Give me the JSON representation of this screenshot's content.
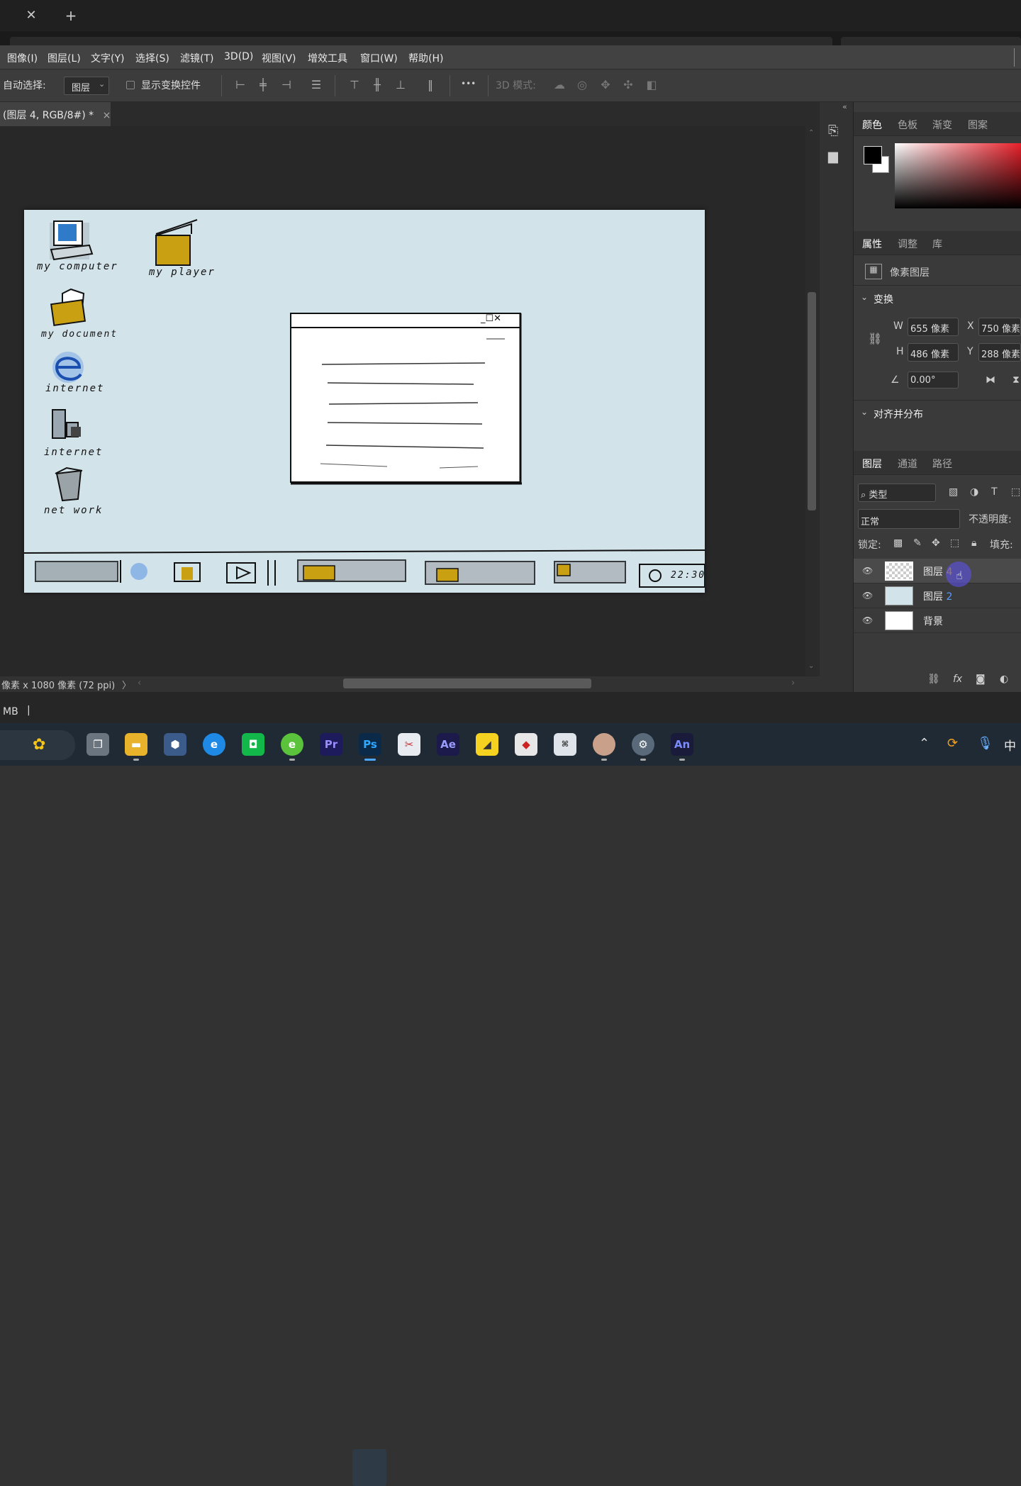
{
  "tabs": {
    "close_glyph": "✕",
    "new_glyph": "+"
  },
  "menu": [
    "图像(I)",
    "图层(L)",
    "文字(Y)",
    "选择(S)",
    "滤镜(T)",
    "3D(D)",
    "视图(V)",
    "增效工具",
    "窗口(W)",
    "帮助(H)"
  ],
  "options": {
    "auto_select_label": "自动选择:",
    "auto_select_value": "图层",
    "show_transform_label": "显示变换控件",
    "more_glyph": "•••",
    "mode_3d_label": "3D 模式:"
  },
  "document": {
    "tab_title": "(图层 4, RGB/8#) *",
    "tab_close": "×"
  },
  "status": {
    "doc_info": "像素 x 1080 像素 (72 ppi)",
    "arrow": "〉",
    "memory": "MB"
  },
  "artboard": {
    "icons": [
      {
        "label": "my computer"
      },
      {
        "label": "my player"
      },
      {
        "label": "my document"
      },
      {
        "label": "internet"
      },
      {
        "label": "internet"
      },
      {
        "label": "net work"
      }
    ],
    "window_controls": "_☐✕",
    "clock": "22:30"
  },
  "color_panel": {
    "tabs": [
      "颜色",
      "色板",
      "渐变",
      "图案"
    ],
    "active": "颜色",
    "fg": "#000000",
    "bg": "#ffffff"
  },
  "properties": {
    "tabs": [
      "属性",
      "调整",
      "库"
    ],
    "layer_type": "像素图层",
    "transform_heading": "变换",
    "w_label": "W",
    "w_value": "655 像素",
    "h_label": "H",
    "h_value": "486 像素",
    "x_label": "X",
    "x_value": "750 像素",
    "y_label": "Y",
    "y_value": "288 像素",
    "angle_value": "0.00°",
    "align_heading": "对齐并分布"
  },
  "layers_panel": {
    "tabs": [
      "图层",
      "通道",
      "路径"
    ],
    "filter_label": "类型",
    "blend_mode": "正常",
    "opacity_label": "不透明度:",
    "lock_label": "锁定:",
    "fill_label": "填充:",
    "layers": [
      {
        "name": "图层",
        "num": "4",
        "selected": true
      },
      {
        "name": "图层",
        "num": "2",
        "selected": false
      },
      {
        "name": "背景",
        "num": "",
        "selected": false
      }
    ],
    "footer_fx": "fx"
  },
  "taskbar": {
    "apps": [
      "explorer",
      "files",
      "virtualbox",
      "edge",
      "wechat",
      "browser360",
      "Pr",
      "Ps",
      "snipping",
      "Ae",
      "notes",
      "winrar",
      "keyboard",
      "avatar",
      "settings",
      "An"
    ],
    "labels": {
      "pr": "Pr",
      "ps": "Ps",
      "ae": "Ae",
      "an": "An"
    },
    "ime": "中"
  }
}
